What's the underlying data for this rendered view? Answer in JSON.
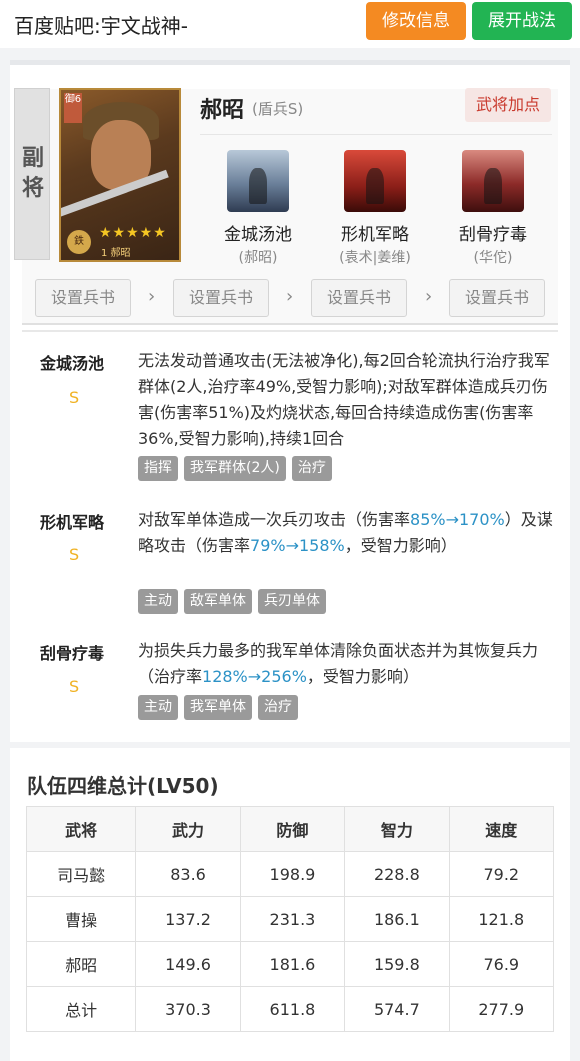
{
  "header": {
    "title": "百度贴吧:宇文战神-",
    "edit_button": "修改信息",
    "expand_button": "展开战法",
    "edit_color": "#f48a22",
    "expand_color": "#22b453"
  },
  "general": {
    "role": "副将",
    "name": "郝昭",
    "troop": "(盾兵S)",
    "add_points_button": "武将加点",
    "portrait": {
      "tag": "御6",
      "stars": "★★★★★",
      "level_text": "1 郝昭",
      "badge": "鉄"
    },
    "skills": [
      {
        "name": "金城汤池",
        "source": "(郝昭)"
      },
      {
        "name": "形机军略",
        "source": "(袁术|姜维)"
      },
      {
        "name": "刮骨疗毒",
        "source": "(华佗)"
      }
    ],
    "set_book_label": "设置兵书",
    "chevron": "›"
  },
  "skill_details": [
    {
      "title": "金城汤池",
      "grade": "S",
      "desc": "无法发动普通攻击(无法被净化),每2回合轮流执行治疗我军群体(2人,治疗率49%,受智力影响);对敌军群体造成兵刃伤害(伤害率51%)及灼烧状态,每回合持续造成伤害(伤害率36%,受智力影响),持续1回合",
      "tags": [
        "指挥",
        "我军群体(2人)",
        "治疗"
      ]
    },
    {
      "title": "形机军略",
      "grade": "S",
      "desc_parts": [
        "对敌军单体造成一次兵刃攻击（伤害率",
        "85%→170%",
        "）及谋略攻击（伤害率",
        "79%→158%",
        "，受智力影响）"
      ],
      "tags": [
        "主动",
        "敌军单体",
        "兵刃单体"
      ]
    },
    {
      "title": "刮骨疗毒",
      "grade": "S",
      "desc_parts": [
        "为损失兵力最多的我军单体清除负面状态并为其恢复兵力（治疗率",
        "128%→256%",
        "，受智力影响）"
      ],
      "tags": [
        "主动",
        "我军单体",
        "治疗"
      ]
    }
  ],
  "stats": {
    "title": "队伍四维总计(LV50)",
    "headers": [
      "武将",
      "武力",
      "防御",
      "智力",
      "速度"
    ],
    "rows": [
      [
        "司马懿",
        "83.6",
        "198.9",
        "228.8",
        "79.2"
      ],
      [
        "曹操",
        "137.2",
        "231.3",
        "186.1",
        "121.8"
      ],
      [
        "郝昭",
        "149.6",
        "181.6",
        "159.8",
        "76.9"
      ],
      [
        "总计",
        "370.3",
        "611.8",
        "574.7",
        "277.9"
      ]
    ]
  }
}
